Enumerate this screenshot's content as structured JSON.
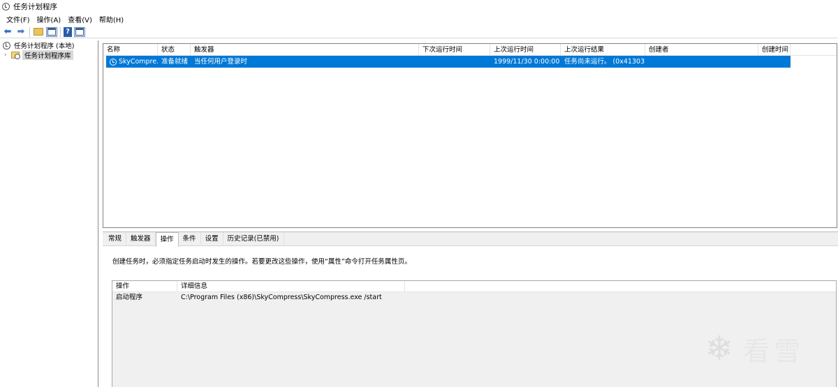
{
  "window": {
    "title": "任务计划程序",
    "icon": "clock-icon"
  },
  "menu": [
    "文件(F)",
    "操作(A)",
    "查看(V)",
    "帮助(H)"
  ],
  "toolbar": {
    "back": "⬅",
    "forward": "➡",
    "help": "?"
  },
  "tree": {
    "root": "任务计划程序 (本地)",
    "child": "任务计划程序库",
    "expand_glyph": "›"
  },
  "list": {
    "columns": [
      "名称",
      "状态",
      "触发器",
      "下次运行时间",
      "上次运行时间",
      "上次运行结果",
      "创建者",
      "创建时间"
    ],
    "rows": [
      {
        "name": "SkyCompre...",
        "status": "准备就绪",
        "trigger": "当任何用户登录时",
        "next_run": "",
        "last_run": "1999/11/30 0:00:00",
        "last_result": "任务尚未运行。 (0x41303)",
        "author": "",
        "created": ""
      }
    ]
  },
  "detail": {
    "tabs": [
      "常规",
      "触发器",
      "操作",
      "条件",
      "设置",
      "历史记录(已禁用)"
    ],
    "active_tab": "操作",
    "description": "创建任务时，必须指定任务启动时发生的操作。若要更改这些操作，使用“属性”命令打开任务属性页。",
    "actions_columns": [
      "操作",
      "详细信息"
    ],
    "actions_rows": [
      {
        "action": "启动程序",
        "details": "C:\\Program Files (x86)\\SkyCompress\\SkyCompress.exe /start"
      }
    ]
  },
  "watermark": {
    "glyph": "❄",
    "text": "看雪"
  },
  "colors": {
    "selection": "#0078d7"
  }
}
